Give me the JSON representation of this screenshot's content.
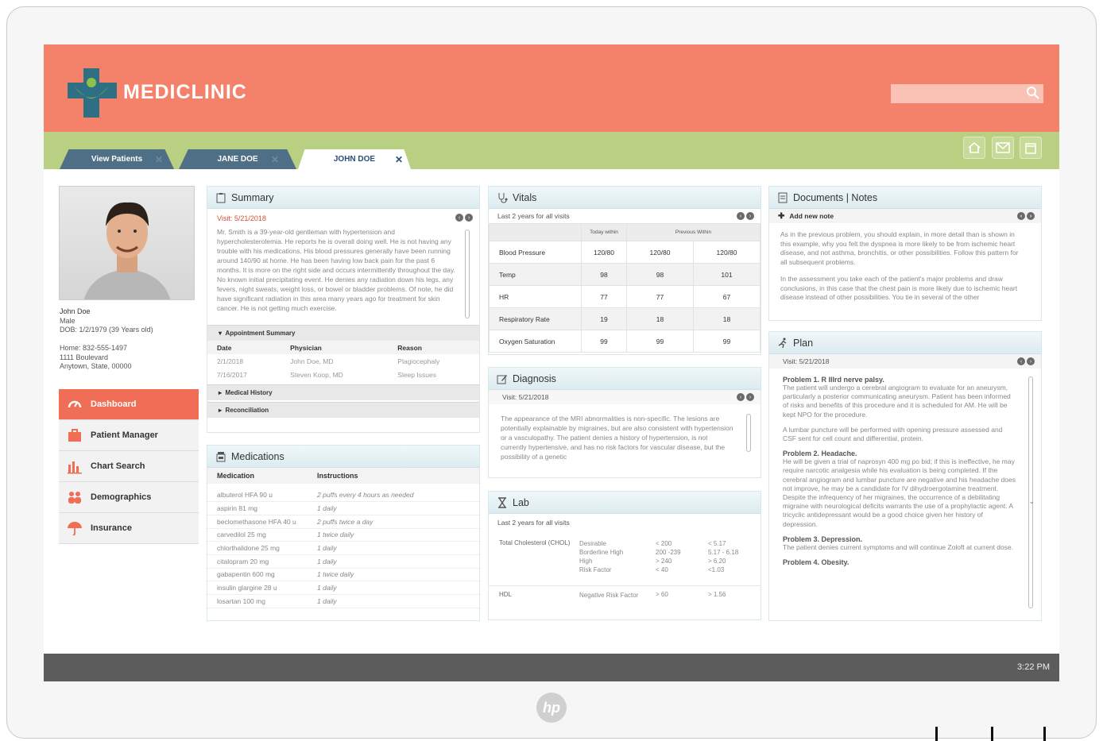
{
  "app": {
    "brand": "MEDICLINIC"
  },
  "tabs": [
    {
      "label": "View Patients"
    },
    {
      "label": "JANE DOE"
    },
    {
      "label": "JOHN DOE"
    }
  ],
  "patient": {
    "name": "John Doe",
    "sex": "Male",
    "dob": "DOB: 1/2/1979 (39 Years old)",
    "home": "Home: 832-555-1497",
    "address1": "1111 Boulevard",
    "address2": "Anytown, State, 00000"
  },
  "menu": [
    {
      "label": "Dashboard"
    },
    {
      "label": "Patient Manager"
    },
    {
      "label": "Chart Search"
    },
    {
      "label": "Demographics"
    },
    {
      "label": "Insurance"
    }
  ],
  "summary": {
    "title": "Summary",
    "visit": "Visit: 5/21/2018",
    "text": "Mr. Smith is a 39-year-old gentleman with hypertension and hypercholesterolemia. He reports he is overall doing well. He is not having any trouble with his medications. His blood pressures generally have been running around 140/90 at home. He has been having low back pain for the past 6 months. It is more on the right side and occurs intermittently throughout the day. No known initial precipitating event. He denies any radiation down his legs, any fevers, night sweats, weight loss, or bowel or bladder problems. Of note, he did have significant radiation in this area many years ago for treatment for skin cancer. He is not getting much exercise.",
    "appointment_title": "Appointment Summary",
    "appointment_headers": [
      "Date",
      "Physician",
      "Reason"
    ],
    "appointments": [
      [
        "2/1/2018",
        "John Doe, MD",
        "Plagiocephaly"
      ],
      [
        "7/16/2017",
        "Steven Koop, MD",
        "Sleep Issues"
      ]
    ],
    "medical_history": "Medical History",
    "reconciliation": "Reconciliation"
  },
  "medications": {
    "title": "Medications",
    "headers": [
      "Medication",
      "Instructions"
    ],
    "rows": [
      [
        "albuterol HFA 90 u",
        "2 puffs every 4 hours as needed"
      ],
      [
        "aspirin 81 mg",
        "1 daily"
      ],
      [
        "beclomethasone HFA 40 u",
        "2 puffs twice a day"
      ],
      [
        "carvedilol 25 mg",
        "1 twice daily"
      ],
      [
        "chlorthalidone 25 mg",
        "1 daily"
      ],
      [
        "citalopram 20 mg",
        "1 daily"
      ],
      [
        "gabapentin 600 mg",
        "1 twice daily"
      ],
      [
        "insulin glargine 28 u",
        "1 daily"
      ],
      [
        "losartan 100 mg",
        "1 daily"
      ]
    ]
  },
  "vitals": {
    "title": "Vitals",
    "sub": "Last 2 years for all visits",
    "col_today": "Today within",
    "col_prev": "Previous Within",
    "rows": [
      [
        "Blood Pressure",
        "120/80",
        "120/80",
        "120/80"
      ],
      [
        "Temp",
        "98",
        "98",
        "101"
      ],
      [
        "HR",
        "77",
        "77",
        "67"
      ],
      [
        "Respiratory Rate",
        "19",
        "18",
        "18"
      ],
      [
        "Oxygen Saturation",
        "99",
        "99",
        "99"
      ]
    ]
  },
  "diagnosis": {
    "title": "Diagnosis",
    "visit": "Visit: 5/21/2018",
    "text": "The appearance of the MRI abnormalities is non-specific. The lesions are potentially explainable by migraines, but are also consistent with hypertension or a vasculopathy. The patient denies a history of hypertension, is not currently hypertensive, and has no risk factors for vascular disease, but the possibility of a genetic"
  },
  "lab": {
    "title": "Lab",
    "sub": "Last 2 years for all visits",
    "rows": [
      {
        "name": "Total Cholesterol (CHOL)",
        "levels": [
          "Desirable",
          "Borderline High",
          "High",
          "Risk Factor"
        ],
        "mg": [
          "< 200",
          "200 -239",
          "> 240",
          "< 40"
        ],
        "mmol": [
          "< 5.17",
          "5.17 - 6.18",
          "> 6.20",
          "<1.03"
        ]
      },
      {
        "name": "HDL",
        "levels": [
          "Negative Risk Factor"
        ],
        "mg": [
          "> 60"
        ],
        "mmol": [
          "> 1.56"
        ]
      }
    ]
  },
  "documents": {
    "title": "Documents | Notes",
    "add": "Add new note",
    "p1": "As in the previous problem, you should explain, in more detail than is shown in this example, why you felt the dyspnea is more likely to be from ischemic heart disease, and not asthma, bronchitis, or other possibilities. Follow this pattern for all subsequent problems.",
    "p2": "In the assessment you take each of the patient's major problems and draw conclusions, in this case that the chest pain is more likely due to ischemic heart disease instead of other possibilities. You tie in several of the other"
  },
  "plan": {
    "title": "Plan",
    "visit": "Visit: 5/21/2018",
    "items": [
      {
        "t": "Problem 1. R IIIrd nerve palsy.",
        "p": "The patient will undergo a cerebral angiogram to evaluate for an aneurysm, particularly a posterior communicating aneurysm. Patient has been informed of risks and benefits of this procedure and it is scheduled for AM. He will be kept NPO for the procedure."
      },
      {
        "t": "",
        "p": "A lumbar puncture will be performed with opening pressure assessed and CSF sent for cell count and differential, protein."
      },
      {
        "t": "Problem 2. Headache.",
        "p": "He will be given a trial of naprosyn 400 mg po bid; if this is ineffective, he may require narcotic analgesia while his evaluation is being completed. If the cerebral angiogram and lumbar puncture are negative and his headache does not improve, he may be a candidate for IV dihydroergotamine treatment. Despite the infrequency of her migraines, the occurrence of a debilitating migraine with neurological deficits warrants the use of a prophylactic agent. A tricyclic antidepressant would be a good choice given her history of depression."
      },
      {
        "t": "Problem 3. Depression.",
        "p": "The patient denies current symptoms and will continue Zoloft at current dose."
      },
      {
        "t": "Problem 4. Obesity.",
        "p": ""
      }
    ]
  },
  "footer": {
    "time": "3:22 PM"
  },
  "device": {
    "logo": "hp"
  },
  "colors": {
    "header": "#f4816a",
    "tabbar": "#b9cf82",
    "tab_dark": "#4f6f86",
    "menu_active": "#ef6e55"
  }
}
